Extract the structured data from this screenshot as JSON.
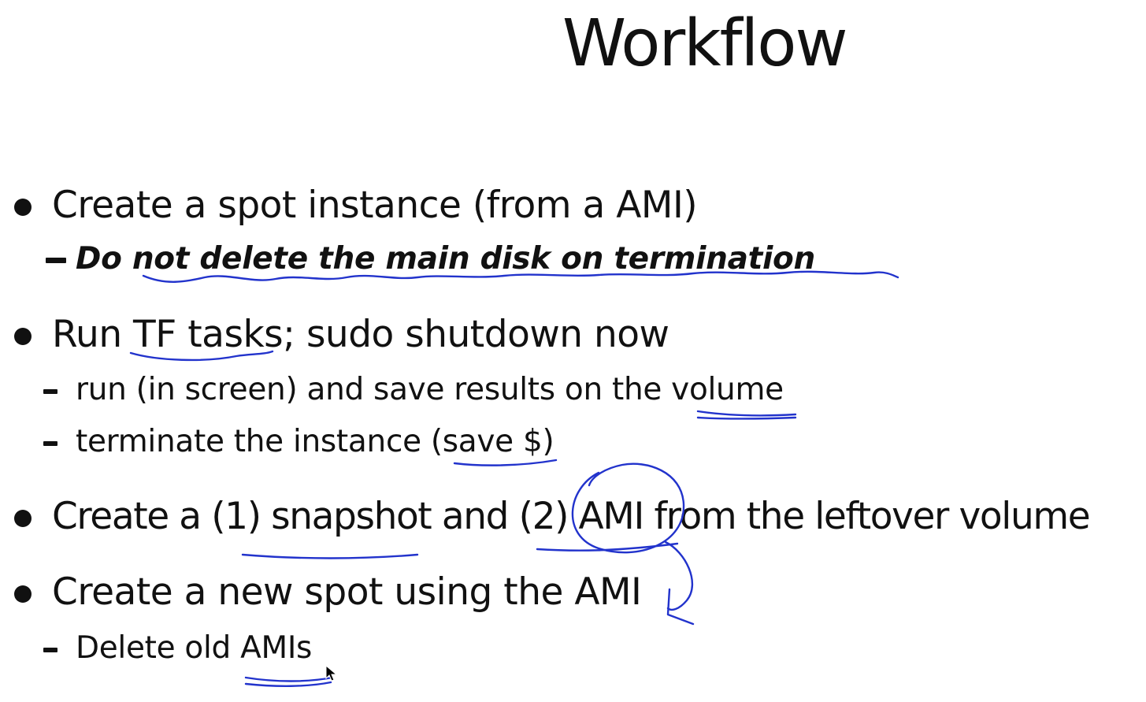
{
  "slide": {
    "title": "Workflow",
    "items": [
      {
        "text": "Create a spot instance (from a AMI)",
        "subitems": [
          {
            "text": "Do not delete the main disk on termination",
            "style": "bold-italic"
          }
        ]
      },
      {
        "text": "Run TF tasks; sudo shutdown now",
        "subitems": [
          {
            "text": "run (in screen) and save results on the volume"
          },
          {
            "text": "terminate the instance (save $)"
          }
        ]
      },
      {
        "text": "Create a (1) snapshot and (2) AMI from the leftover volume",
        "subitems": []
      },
      {
        "text": "Create a new spot using the AMI",
        "subitems": [
          {
            "text": "Delete old AMIs"
          }
        ]
      }
    ]
  },
  "annotations": {
    "ink_color": "#2233cc",
    "marks": [
      "wavy-underline",
      "underline",
      "circle",
      "curved-arrow"
    ]
  },
  "cursor": {
    "icon": "mouse-pointer-icon"
  }
}
